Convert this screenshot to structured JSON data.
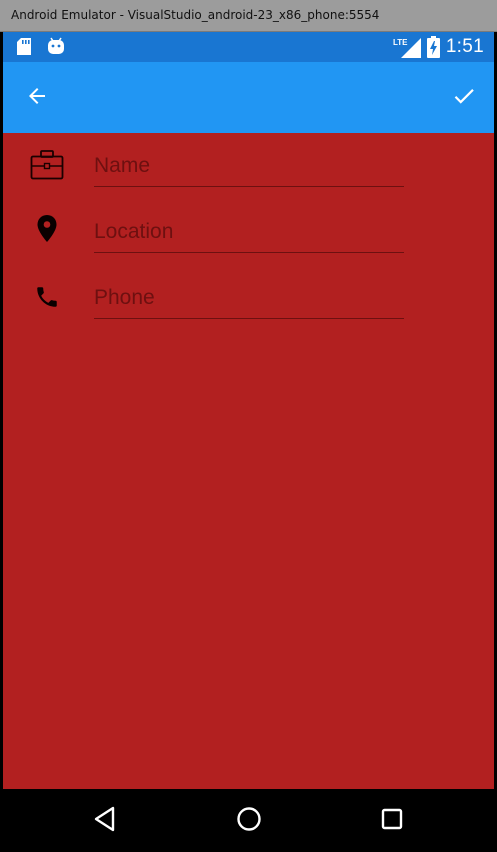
{
  "window": {
    "title": "Android Emulator - VisualStudio_android-23_x86_phone:5554"
  },
  "status_bar": {
    "time": "1:51",
    "network_label": "LTE",
    "icons": [
      "sd-card-icon",
      "android-icon",
      "lte-signal-icon",
      "battery-charging-icon"
    ],
    "background": "#1976d2"
  },
  "app_bar": {
    "back_icon": "arrow-back-icon",
    "confirm_icon": "check-icon",
    "background": "#2196f3"
  },
  "form": {
    "background": "#b22020",
    "fields": [
      {
        "icon": "briefcase-icon",
        "placeholder": "Name",
        "value": ""
      },
      {
        "icon": "location-pin-icon",
        "placeholder": "Location",
        "value": ""
      },
      {
        "icon": "phone-icon",
        "placeholder": "Phone",
        "value": ""
      }
    ]
  },
  "nav_bar": {
    "buttons": [
      "back-triangle-icon",
      "home-circle-icon",
      "recents-square-icon"
    ]
  }
}
